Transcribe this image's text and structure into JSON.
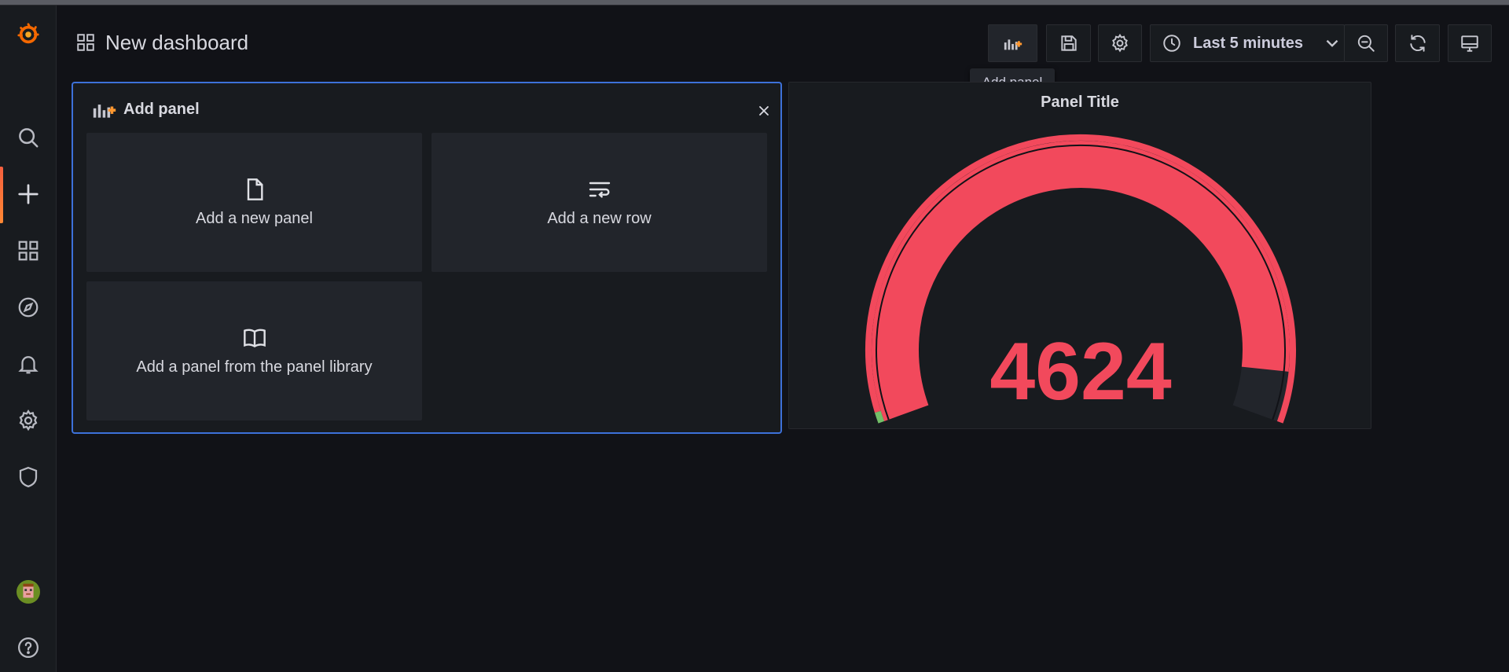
{
  "header": {
    "title": "New dashboard"
  },
  "toolbar": {
    "add_panel_icon": "add-panel-icon",
    "save_icon": "save-icon",
    "settings_icon": "gear-icon",
    "time_range_label": "Last 5 minutes",
    "zoom_icon": "zoom-out-icon",
    "refresh_icon": "refresh-icon",
    "tv_icon": "tv-mode-icon",
    "tooltip": "Add panel"
  },
  "sidebar": {
    "items": [
      {
        "name": "grafana-logo"
      },
      {
        "name": "search"
      },
      {
        "name": "create"
      },
      {
        "name": "dashboards"
      },
      {
        "name": "explore"
      },
      {
        "name": "alerting"
      },
      {
        "name": "configuration"
      },
      {
        "name": "server-admin"
      },
      {
        "name": "profile"
      },
      {
        "name": "help"
      }
    ]
  },
  "add_panel": {
    "title": "Add panel",
    "options": [
      {
        "label": "Add a new panel",
        "icon": "file-icon"
      },
      {
        "label": "Add a new row",
        "icon": "row-wrap-icon"
      },
      {
        "label": "Add a panel from the panel library",
        "icon": "book-icon"
      }
    ]
  },
  "gauge_panel": {
    "title": "Panel Title",
    "value": "4624",
    "colors": {
      "value": "#f2495c",
      "threshold_base": "#73bf69",
      "track": "#22252b"
    }
  },
  "colors": {
    "accent": "#3d71d9",
    "brand": "#f46800"
  }
}
